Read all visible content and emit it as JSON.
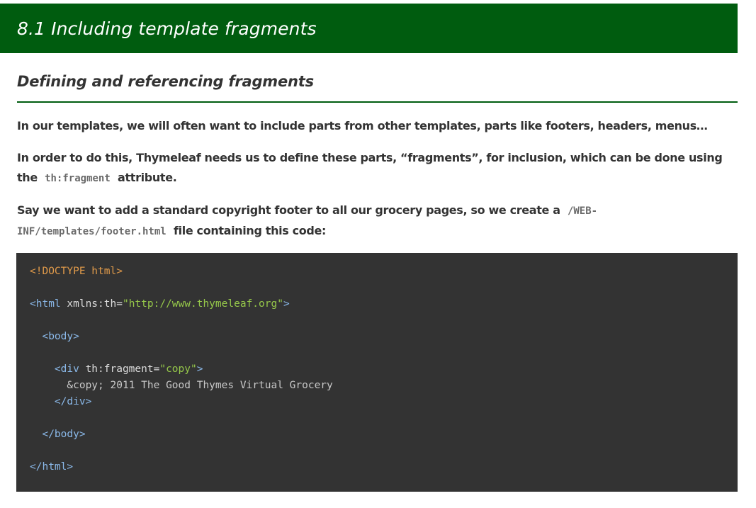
{
  "header": {
    "title": "8.1 Including template fragments",
    "background": "#005c0f"
  },
  "subsection": {
    "title": "Defining and referencing fragments"
  },
  "paragraphs": {
    "p1": "In our templates, we will often want to include parts from other templates, parts like footers, headers, menus…",
    "p2_before": "In order to do this, Thymeleaf needs us to define these parts, “fragments”, for inclusion, which can be done using the",
    "p2_code": "th:fragment",
    "p2_after": "attribute.",
    "p3_before": "Say we want to add a standard copyright footer to all our grocery pages, so we create a",
    "p3_code": "/WEB-INF/templates/footer.html",
    "p3_after": "file containing this code:"
  },
  "code": {
    "doctype": "<!DOCTYPE html>",
    "html_open": "<html",
    "xmlns_attr": "xmlns:th",
    "xmlns_value": "\"http://www.thymeleaf.org\"",
    "tag_close": ">",
    "body_open": "<body>",
    "div_open": "<div",
    "fragment_attr": "th:fragment",
    "fragment_value": "\"copy\"",
    "div_content": "&copy; 2011 The Good Thymes Virtual Grocery",
    "div_close": "</div>",
    "body_close": "</body>",
    "html_close": "</html>",
    "equals": "="
  },
  "colors": {
    "code_background": "#333333",
    "doctype": "#e09a4a",
    "tag": "#8ab8e8",
    "string": "#96c84a"
  }
}
